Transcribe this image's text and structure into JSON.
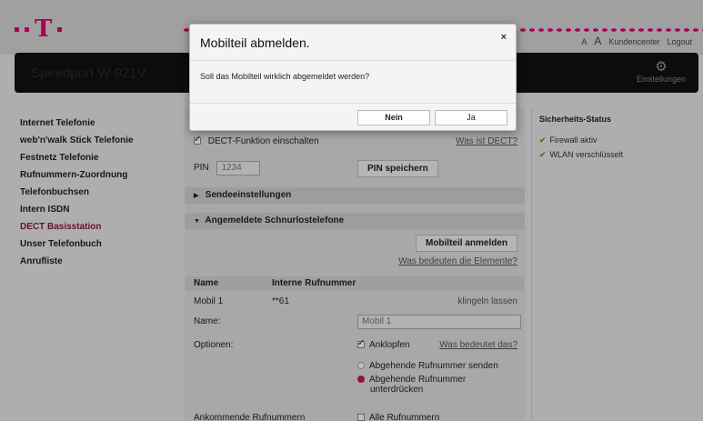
{
  "header": {
    "font_size_small": "A",
    "font_size_large": "A",
    "customer_center": "Kundencenter",
    "logout": "Logout",
    "product_name": "Speedport W 921V",
    "settings_label": "Einstellungen"
  },
  "sidebar": {
    "items": [
      {
        "label": "Internet Telefonie"
      },
      {
        "label": "web'n'walk Stick Telefonie"
      },
      {
        "label": "Festnetz Telefonie"
      },
      {
        "label": "Rufnummern-Zuordnung"
      },
      {
        "label": "Telefonbuchsen"
      },
      {
        "label": "Intern ISDN"
      },
      {
        "label": "DECT Basisstation"
      },
      {
        "label": "Unser Telefonbuch"
      },
      {
        "label": "Anrufliste"
      }
    ],
    "active_index": 6
  },
  "main": {
    "dect_enable_label": "DECT-Funktion einschalten",
    "what_is_dect": "Was ist DECT?",
    "pin_label": "PIN",
    "pin_value": "1234",
    "save_pin": "PIN speichern",
    "section_send": "Sendeeinstellungen",
    "section_registered": "Angemeldete Schnurlostelefone",
    "register_button": "Mobilteil anmelden",
    "what_elements": "Was bedeuten die Elemente?",
    "table": {
      "col_name": "Name",
      "col_internal": "Interne Rufnummer",
      "row_name": "Mobil 1",
      "row_number": "**61",
      "row_action": "klingeln lassen"
    },
    "name_label": "Name:",
    "name_value": "Mobil 1",
    "options_label": "Optionen:",
    "call_waiting": "Anklopfen",
    "what_is_that": "Was bedeutet das?",
    "send_number": "Abgehende Rufnummer senden",
    "suppress_number_line1": "Abgehende Rufnummer",
    "suppress_number_line2": "unterdrücken",
    "incoming_label": "Ankommende Rufnummern",
    "all_numbers": "Alle Rufnummern"
  },
  "right": {
    "title": "Sicherheits-Status",
    "items": [
      {
        "label": "Firewall aktiv"
      },
      {
        "label": "WLAN verschlüsselt"
      }
    ]
  },
  "modal": {
    "title": "Mobilteil abmelden.",
    "close": "×",
    "message": "Soll das Mobilteil wirklich abgemeldet werden?",
    "no": "Nein",
    "yes": "Ja"
  },
  "colors": {
    "brand": "#e20074",
    "active_nav": "#8a1a3c"
  }
}
